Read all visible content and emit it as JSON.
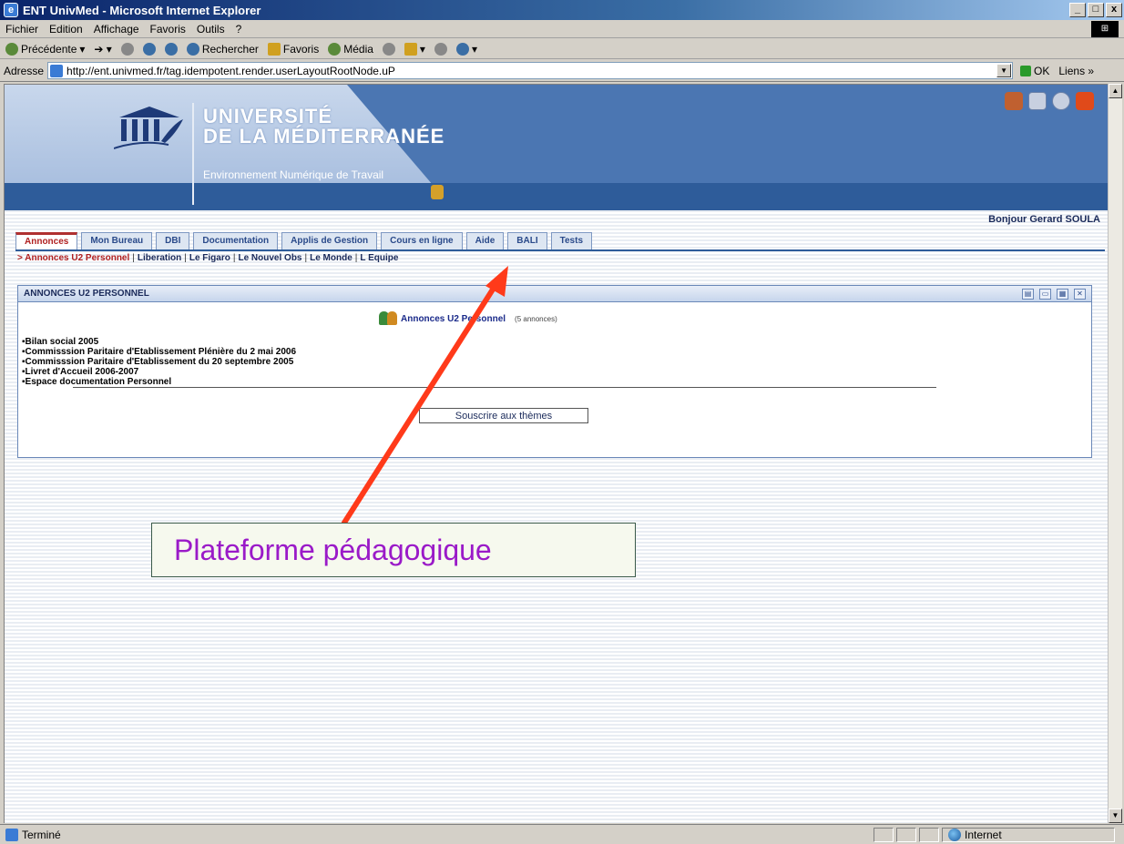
{
  "window": {
    "title": "ENT UnivMed - Microsoft Internet Explorer",
    "btn_min": "_",
    "btn_max": "□",
    "btn_close": "x"
  },
  "menu": [
    "Fichier",
    "Edition",
    "Affichage",
    "Favoris",
    "Outils",
    "?"
  ],
  "toolbar": {
    "back": "Précédente",
    "search": "Rechercher",
    "favorites": "Favoris",
    "media": "Média"
  },
  "address": {
    "label": "Adresse",
    "url": "http://ent.univmed.fr/tag.idempotent.render.userLayoutRootNode.uP",
    "go": "OK",
    "links": "Liens"
  },
  "banner": {
    "line1": "UNIVERSITÉ",
    "line2": "DE LA MÉDITERRANÉE",
    "subtitle": "Environnement Numérique de Travail"
  },
  "greeting": "Bonjour Gerard SOULA",
  "tabs": [
    {
      "label": "Annonces",
      "active": true
    },
    {
      "label": "Mon Bureau",
      "active": false
    },
    {
      "label": "DBI",
      "active": false
    },
    {
      "label": "Documentation",
      "active": false
    },
    {
      "label": "Applis de Gestion",
      "active": false
    },
    {
      "label": "Cours en ligne",
      "active": false
    },
    {
      "label": "Aide",
      "active": false
    },
    {
      "label": "BALI",
      "active": false
    },
    {
      "label": "Tests",
      "active": false
    }
  ],
  "subnav": {
    "current": "> Annonces U2 Personnel",
    "items": [
      "Liberation",
      "Le Figaro",
      "Le Nouvel Obs",
      "Le Monde",
      "L Equipe"
    ]
  },
  "channel": {
    "title": "ANNONCES U2 PERSONNEL",
    "heading": "Annonces U2 Personnel",
    "count": "(5 annonces)",
    "items": [
      "Bilan social 2005",
      "Commisssion Paritaire d'Etablissement Plénière du 2 mai 2006",
      "Commisssion Paritaire d'Etablissement du 20 septembre 2005",
      "Livret d'Accueil 2006-2007",
      "Espace documentation Personnel"
    ],
    "subscribe": "Souscrire aux thèmes"
  },
  "callout": "Plateforme pédagogique",
  "status": {
    "text": "Terminé",
    "zone": "Internet"
  },
  "colors": {
    "accent": "#2e5c9a",
    "active_tab": "#b02020",
    "arrow": "#ff3a1a",
    "callout_text": "#9a1ac8"
  }
}
